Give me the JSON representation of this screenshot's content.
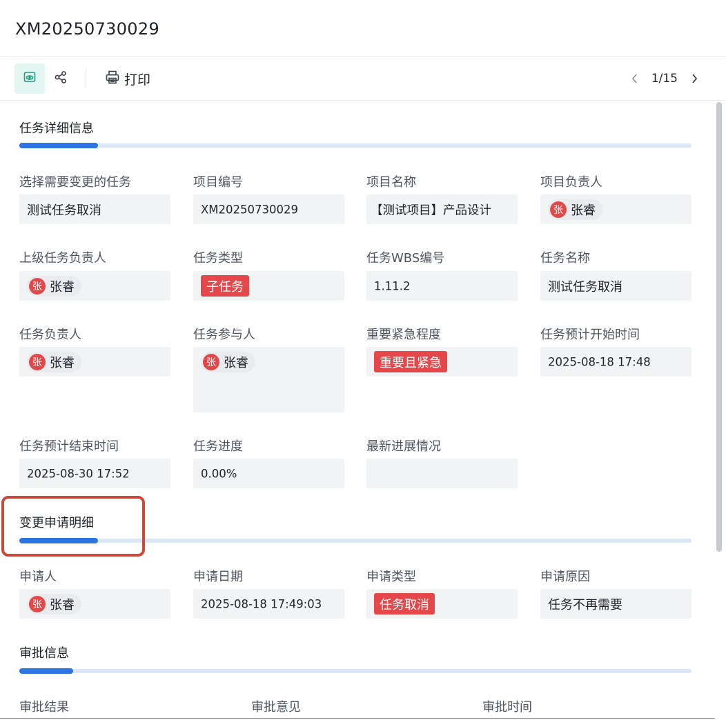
{
  "header": {
    "title": "XM20250730029"
  },
  "toolbar": {
    "print_label": "打印",
    "pager": "1/15"
  },
  "sections": {
    "task_detail": "任务详细信息",
    "change_detail": "变更申请明细",
    "approval": "审批信息"
  },
  "task_fields": {
    "select_task": {
      "label": "选择需要变更的任务",
      "value": "测试任务取消"
    },
    "project_no": {
      "label": "项目编号",
      "value": "XM20250730029"
    },
    "project_name": {
      "label": "项目名称",
      "value": "【测试项目】产品设计"
    },
    "project_owner": {
      "label": "项目负责人",
      "avatar": "张",
      "value": "张睿"
    },
    "parent_owner": {
      "label": "上级任务负责人",
      "avatar": "张",
      "value": "张睿"
    },
    "task_type": {
      "label": "任务类型",
      "value": "子任务"
    },
    "wbs": {
      "label": "任务WBS编号",
      "value": "1.11.2"
    },
    "task_name": {
      "label": "任务名称",
      "value": "测试任务取消"
    },
    "task_owner": {
      "label": "任务负责人",
      "avatar": "张",
      "value": "张睿"
    },
    "participants": {
      "label": "任务参与人",
      "avatar": "张",
      "value": "张睿"
    },
    "priority": {
      "label": "重要紧急程度",
      "value": "重要且紧急"
    },
    "start_time": {
      "label": "任务预计开始时间",
      "value": "2025-08-18 17:48"
    },
    "end_time": {
      "label": "任务预计结束时间",
      "value": "2025-08-30 17:52"
    },
    "progress": {
      "label": "任务进度",
      "value": "0.00%"
    },
    "latest": {
      "label": "最新进展情况",
      "value": ""
    }
  },
  "change_fields": {
    "applicant": {
      "label": "申请人",
      "avatar": "张",
      "value": "张睿"
    },
    "apply_date": {
      "label": "申请日期",
      "value": "2025-08-18 17:49:03"
    },
    "apply_type": {
      "label": "申请类型",
      "value": "任务取消"
    },
    "apply_reason": {
      "label": "申请原因",
      "value": "任务不再需要"
    }
  },
  "approval_columns": [
    "审批结果",
    "审批意见",
    "审批时间"
  ],
  "colors": {
    "accent": "#2d75e0",
    "tag_red": "#e4484b",
    "highlight": "#c94a3a",
    "active_btn": "#e3f6f2"
  }
}
